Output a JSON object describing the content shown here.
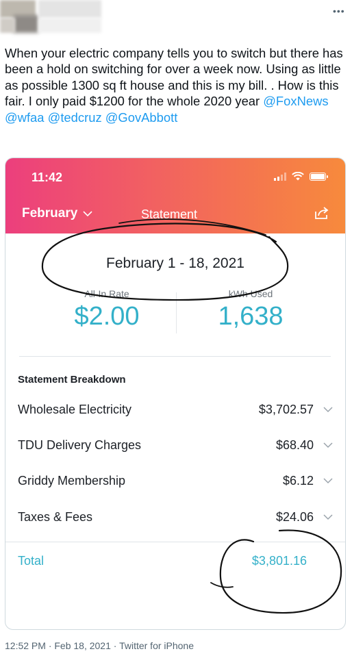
{
  "tweet": {
    "more_icon": "more-options-icon",
    "text_plain": "When your electric company tells you to switch but there has been a hold on switching for over  a week now. Using as little as possible 1300 sq ft house and this is my bill. . How is this fair. I only paid $1200 for the whole 2020 year ",
    "mentions": [
      "@FoxNews",
      "@wfaa",
      "@tedcruz",
      "@GovAbbott"
    ],
    "meta": "12:52 PM · Feb 18, 2021 · Twitter for iPhone",
    "mention_color": "#1d9bf0"
  },
  "app": {
    "status_time": "11:42",
    "month": "February",
    "statement_label": "Statement",
    "date_range": "February 1 - 18, 2021",
    "all_in_rate_label": "All-In Rate",
    "all_in_rate_value": "$2.00",
    "kwh_label": "kWh Used",
    "kwh_value": "1,638",
    "breakdown_title": "Statement Breakdown",
    "items": [
      {
        "name": "Wholesale Electricity",
        "amount": "$3,702.57"
      },
      {
        "name": "TDU Delivery Charges",
        "amount": "$68.40"
      },
      {
        "name": "Griddy Membership",
        "amount": "$6.12"
      },
      {
        "name": "Taxes & Fees",
        "amount": "$24.06"
      }
    ],
    "total_label": "Total",
    "total_amount": "$3,801.16",
    "accent_color": "#33b0c9",
    "header_gradient": [
      "#ec3f7d",
      "#f78a3c"
    ]
  }
}
